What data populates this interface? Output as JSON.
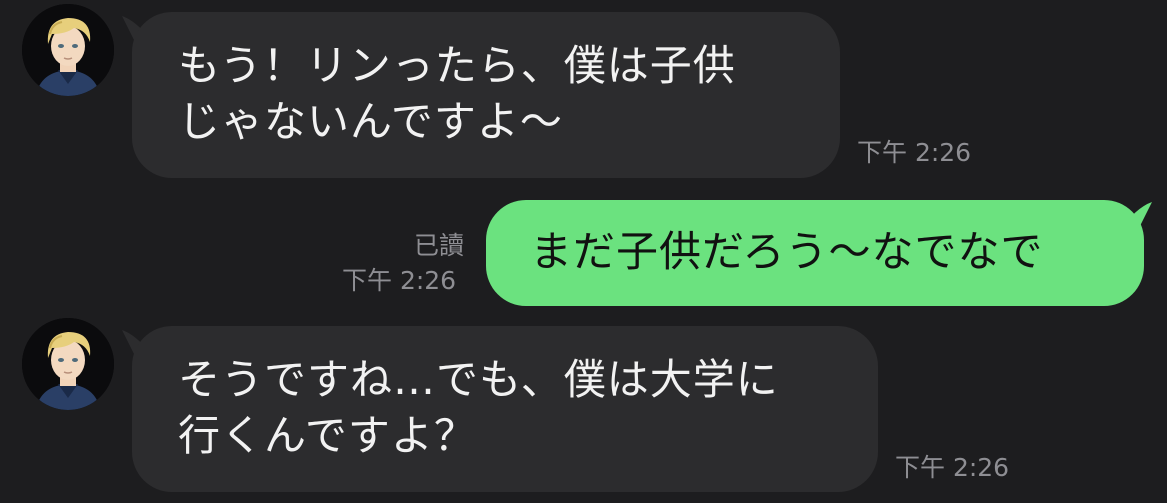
{
  "messages": [
    {
      "direction": "incoming",
      "avatar_icon": "blonde-boy-avatar-icon",
      "lines": [
        "もう！リンったら、僕は子供",
        "じゃないんですよ～"
      ],
      "time": "下午 2:26"
    },
    {
      "direction": "outgoing",
      "read_label": "已讀",
      "lines": [
        "まだ子供だろう～なでなで"
      ],
      "time": "下午 2:26"
    },
    {
      "direction": "incoming",
      "avatar_icon": "blonde-boy-avatar-icon",
      "lines": [
        "そうですね…でも、僕は大学に",
        "行くんですよ？"
      ],
      "time": "下午 2:26"
    }
  ],
  "colors": {
    "background": "#1d1d1f",
    "incoming_bubble": "#2c2c2e",
    "outgoing_bubble": "#6be27f",
    "timestamp": "#8e8e93"
  }
}
